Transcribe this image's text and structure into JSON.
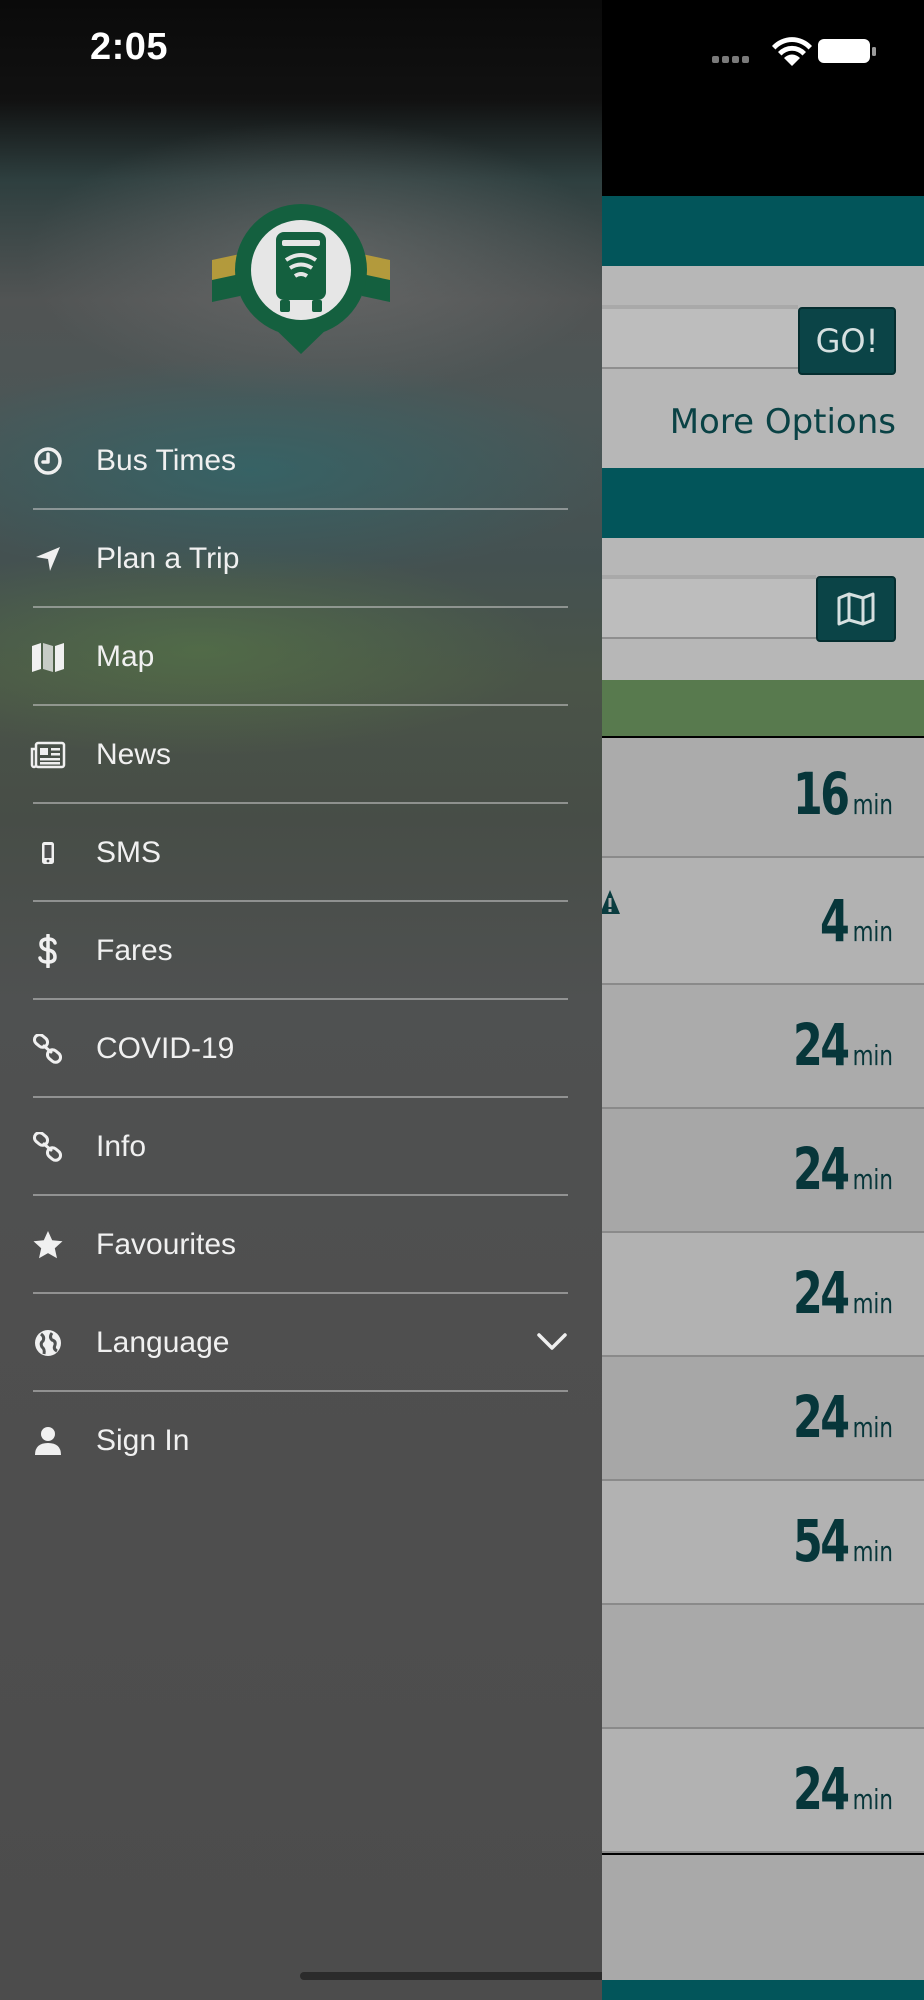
{
  "status_bar": {
    "time": "2:05"
  },
  "background": {
    "go_label": "GO!",
    "more_options_label": "More Options",
    "arrivals": [
      {
        "minutes": "16",
        "unit": "min"
      },
      {
        "minutes": "4",
        "unit": "min"
      },
      {
        "minutes": "24",
        "unit": "min"
      },
      {
        "minutes": "24",
        "unit": "min"
      },
      {
        "minutes": "24",
        "unit": "min"
      },
      {
        "minutes": "24",
        "unit": "min"
      },
      {
        "minutes": "54",
        "unit": "min"
      },
      {
        "minutes": "",
        "unit": ""
      },
      {
        "minutes": "24",
        "unit": "min"
      }
    ]
  },
  "drawer": {
    "logo": "bus-location-logo",
    "menu": [
      {
        "label": "Bus Times",
        "icon": "clock-icon"
      },
      {
        "label": "Plan a Trip",
        "icon": "location-arrow-icon"
      },
      {
        "label": "Map",
        "icon": "map-icon"
      },
      {
        "label": "News",
        "icon": "newspaper-icon"
      },
      {
        "label": "SMS",
        "icon": "mobile-phone-icon"
      },
      {
        "label": "Fares",
        "icon": "dollar-icon"
      },
      {
        "label": "COVID-19",
        "icon": "link-icon"
      },
      {
        "label": "Info",
        "icon": "link-icon"
      },
      {
        "label": "Favourites",
        "icon": "star-icon"
      },
      {
        "label": "Language",
        "icon": "globe-icon",
        "expandable": true
      },
      {
        "label": "Sign In",
        "icon": "user-icon"
      }
    ]
  },
  "colors": {
    "teal": "#02555a",
    "dark_teal": "#0b4447",
    "green_accent": "#587a4e",
    "logo_green": "#14603f",
    "logo_gold": "#b39a3c"
  }
}
